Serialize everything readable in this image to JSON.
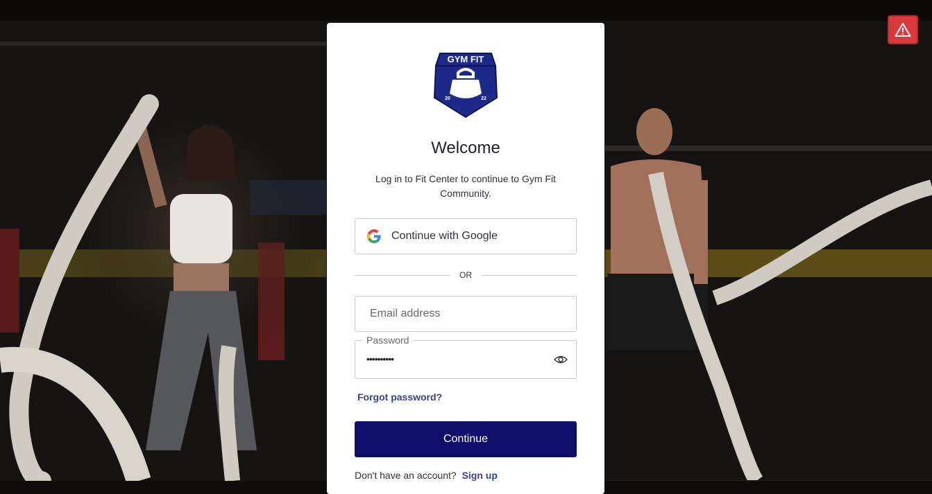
{
  "background": {
    "description_icon": "gym-battle-ropes-photo"
  },
  "alert": {
    "icon": "warning-triangle-icon",
    "color": "#d9393a"
  },
  "login": {
    "logo_text": "GYM FIT",
    "logo_year_left": "20",
    "logo_year_right": "22",
    "title": "Welcome",
    "subtitle": "Log in to Fit Center to continue to Gym Fit Community.",
    "google_button": "Continue with Google",
    "divider": "OR",
    "email_placeholder": "Email address",
    "password_label": "Password",
    "password_masked": "••••••••••",
    "forgot_password": "Forgot password?",
    "continue_button": "Continue",
    "signup_prompt": "Don't have an account?",
    "signup_link": "Sign up"
  },
  "colors": {
    "primary": "#0f0e6b",
    "link": "#3a3f8f",
    "logo_blue": "#1e2a8a"
  }
}
